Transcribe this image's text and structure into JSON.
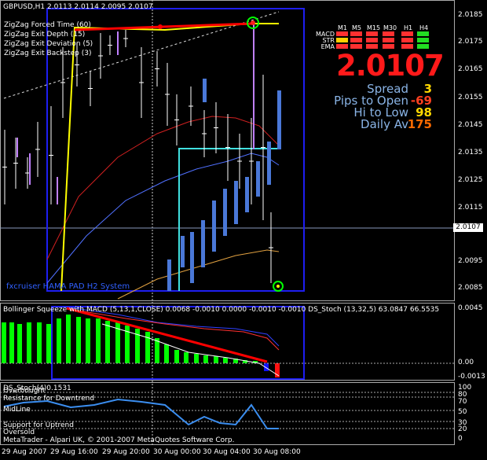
{
  "header": {
    "symbol_line": "GBPUSD,H1  2.0113 2.0114 2.0095 2.0107",
    "indicators": [
      "ZigZag Forced Time (60)",
      "ZigZag Exit Depth (15)",
      "ZigZag Exit Deviation (5)",
      "ZigZag Exit Backstep (3)"
    ]
  },
  "system_label": "fxcruiser HAMA PAD H2 System",
  "price_axis": [
    "2.0185",
    "2.0175",
    "2.0165",
    "2.0155",
    "2.0145",
    "2.0135",
    "2.0125",
    "2.0115",
    "2.0095",
    "2.0085"
  ],
  "current_price_box": "2.0107",
  "dashboard": {
    "timeframes": [
      "M1",
      "M5",
      "M15",
      "M30",
      "H1",
      "H4"
    ],
    "rows": [
      {
        "label": "MACD",
        "colors": [
          "#ff3030",
          "#ff3030",
          "#ff3030",
          "#ff3030",
          "#ff3030",
          "#22dd22"
        ]
      },
      {
        "label": "STR",
        "colors": [
          "#ffd000",
          "#ff3030",
          "#ff3030",
          "#ff3030",
          "#ff3030",
          "#22dd22"
        ]
      },
      {
        "label": "EMA",
        "colors": [
          "#ff3030",
          "#ff3030",
          "#ff3030",
          "#ff3030",
          "#ff3030",
          "#22dd22"
        ]
      }
    ],
    "big_price": "2.0107",
    "stats": [
      {
        "label": "Spread",
        "value": "3",
        "color": "#ffd700"
      },
      {
        "label": "Pips to Open",
        "value": "-69",
        "color": "#ff4020"
      },
      {
        "label": "Hi to Low",
        "value": "98",
        "color": "#ffd700"
      },
      {
        "label": "Daily Av",
        "value": "175",
        "color": "#ff6a00"
      }
    ]
  },
  "sub1": {
    "title": "Bollinger Squeeze with MACD (5,13,1,CLOSE) 0.0068 -0.0010 0.0000 -0.0010 -0.0010   DS_Stoch (13,32,5) 63.0847 66.5535",
    "axis": [
      "0.0045",
      "0.00",
      "-0.0013"
    ]
  },
  "sub2": {
    "title": "DS_Stoch(4)0.1531",
    "levels": [
      "Resistance for Downtrend",
      "MidLine",
      "Support for Uptrend",
      "Oversold"
    ],
    "level_overbought": "Overbought",
    "axis": [
      "100",
      "80",
      "70",
      "50",
      "30",
      "20",
      "0"
    ],
    "copyright": "MetaTrader - Alpari UK, © 2001-2007 MetaQuotes Software Corp."
  },
  "time_axis": [
    "29 Aug 2007",
    "29 Aug 16:00",
    "29 Aug 20:00",
    "30 Aug 00:00",
    "30 Aug 04:00",
    "30 Aug 08:00"
  ],
  "colors": {
    "accent_red": "#ff0000",
    "zigzag_yellow": "#ffff00",
    "box_blue": "#1e1ef0",
    "hist_green": "#00ff00",
    "candle_blue": "#4a78d8",
    "magenta": "#c080ff"
  }
}
